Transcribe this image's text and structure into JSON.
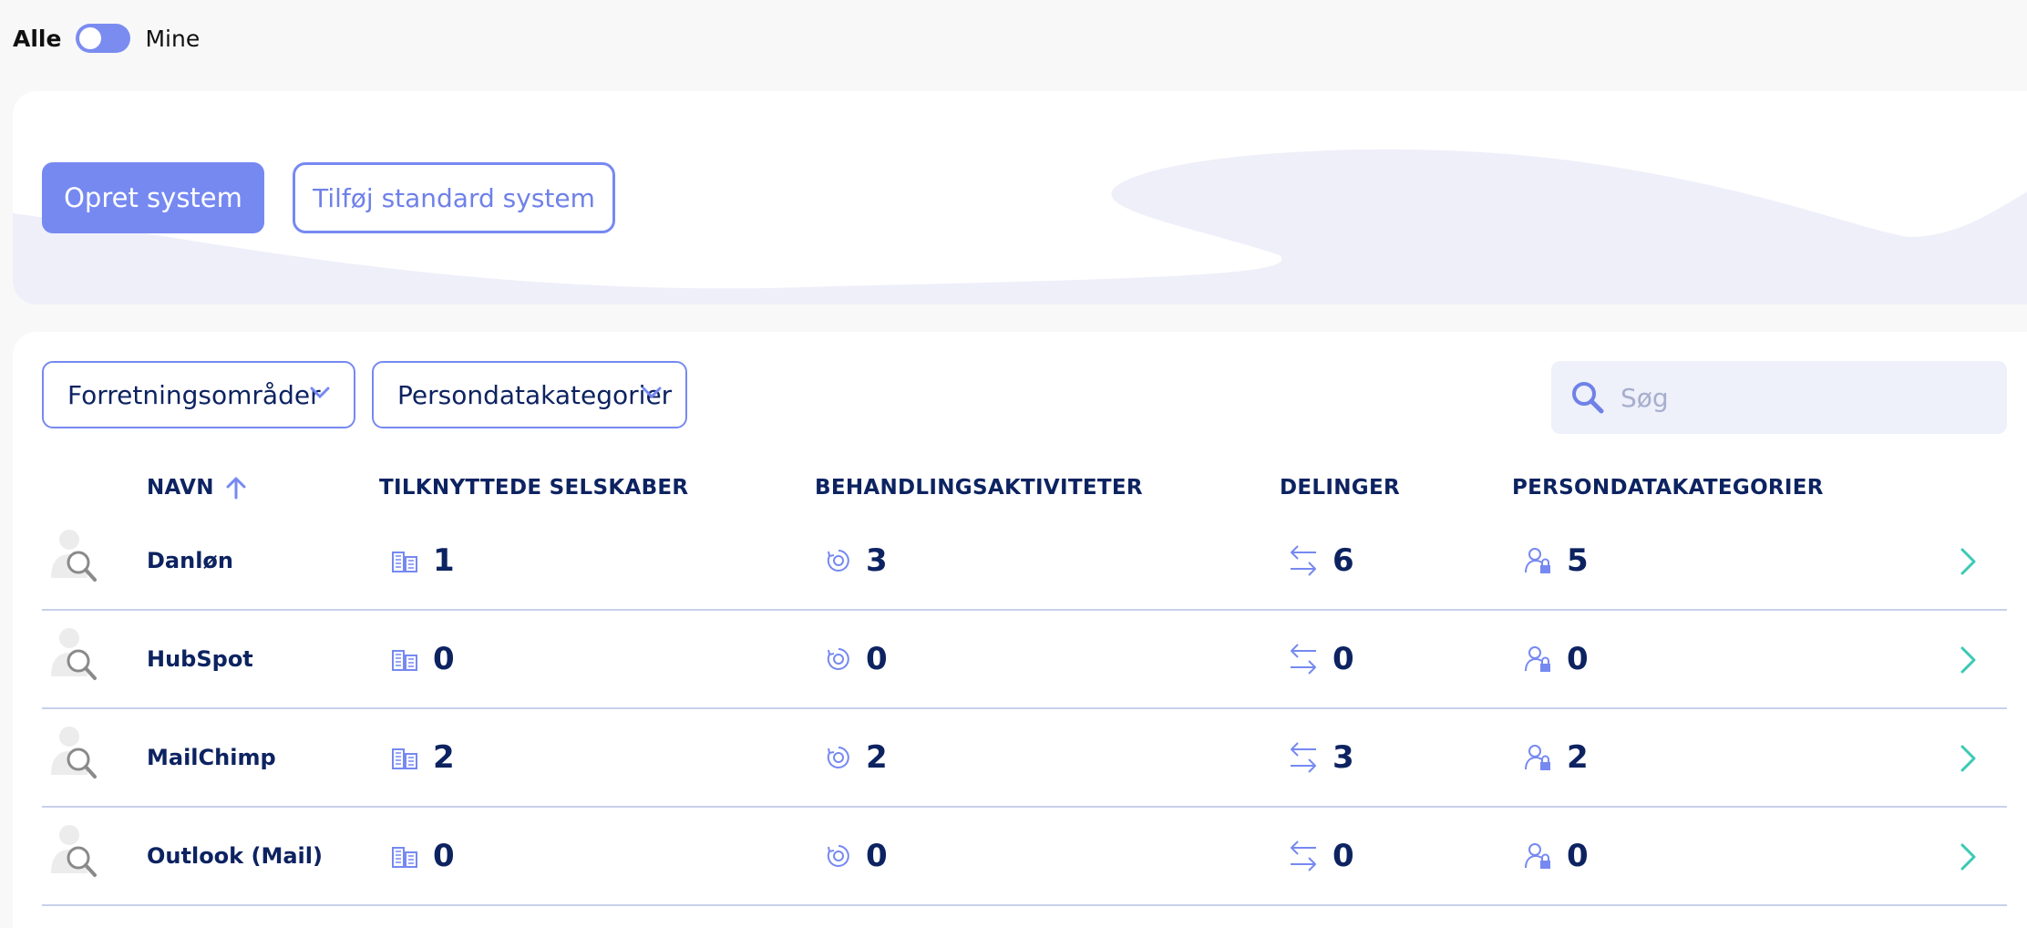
{
  "toggle": {
    "left_label": "Alle",
    "right_label": "Mine"
  },
  "hero": {
    "create_label": "Opret system",
    "add_standard_label": "Tilføj standard system"
  },
  "filters": {
    "business_areas": "Forretningsområder",
    "data_categories": "Persondatakategorier"
  },
  "search": {
    "placeholder": "Søg"
  },
  "table": {
    "headers": {
      "name": "NAVN",
      "companies": "TILKNYTTEDE SELSKABER",
      "activities": "BEHANDLINGSAKTIVITETER",
      "sharings": "DELINGER",
      "categories": "PERSONDATAKATEGORIER"
    },
    "rows": [
      {
        "name": "Danløn",
        "companies": "1",
        "activities": "3",
        "sharings": "6",
        "categories": "5"
      },
      {
        "name": "HubSpot",
        "companies": "0",
        "activities": "0",
        "sharings": "0",
        "categories": "0"
      },
      {
        "name": "MailChimp",
        "companies": "2",
        "activities": "2",
        "sharings": "3",
        "categories": "2"
      },
      {
        "name": "Outlook (Mail)",
        "companies": "0",
        "activities": "0",
        "sharings": "0",
        "categories": "0"
      }
    ]
  },
  "colors": {
    "accent": "#7689f1",
    "navy": "#0d2361",
    "teal": "#3cc9b4",
    "wave": "#efeffa"
  },
  "icons": {
    "sort": "arrow-up-icon",
    "companies": "building-icon",
    "activities": "processing-icon",
    "sharings": "swap-arrows-icon",
    "categories": "user-lock-icon",
    "row_open": "chevron-right-icon",
    "system": "user-search-icon"
  }
}
